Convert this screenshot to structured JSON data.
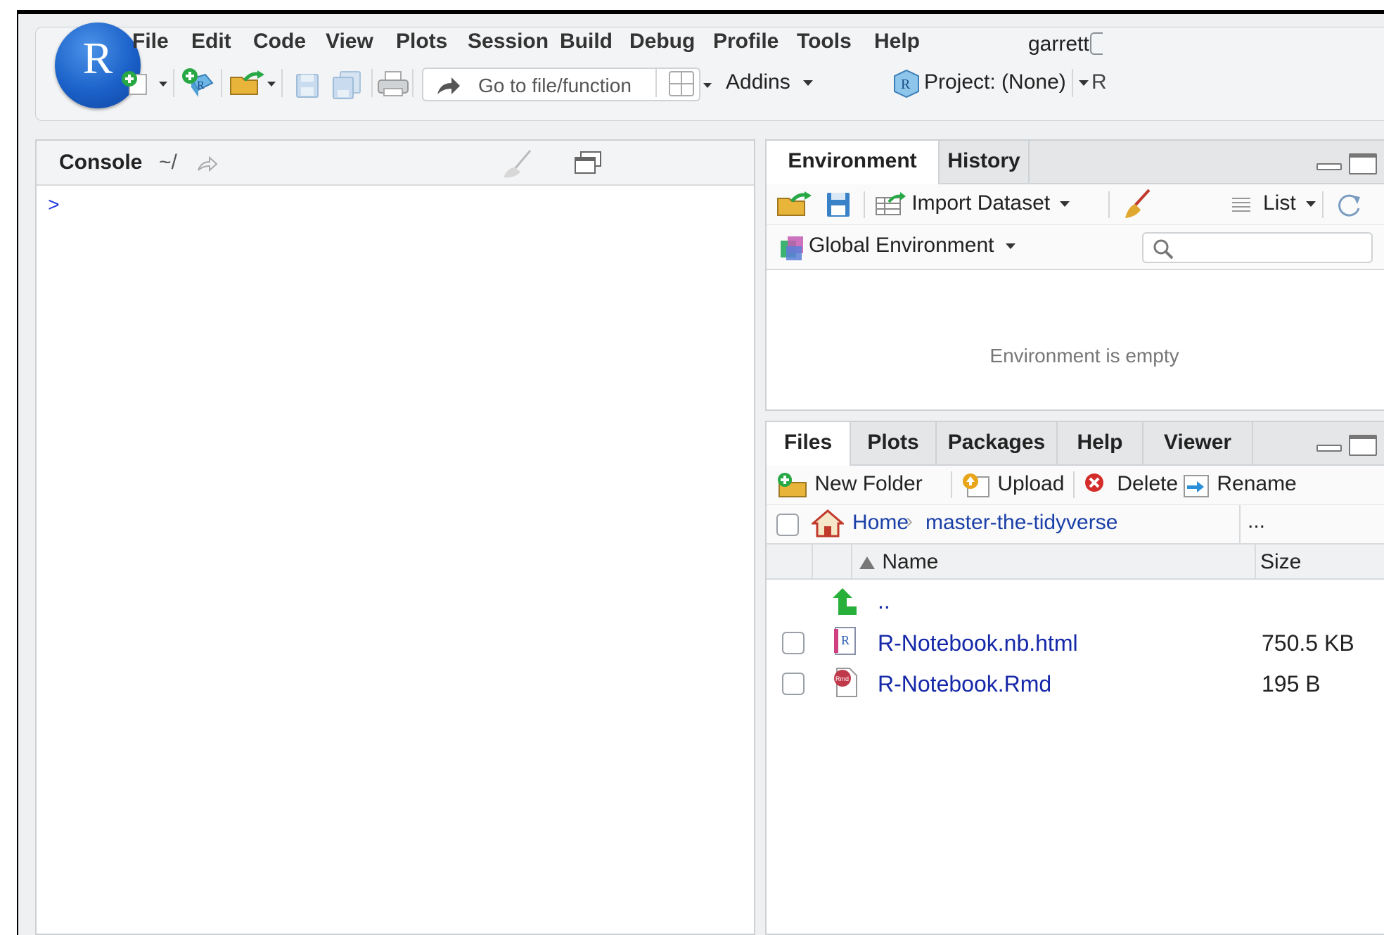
{
  "menu": [
    "File",
    "Edit",
    "Code",
    "View",
    "Plots",
    "Session",
    "Build",
    "Debug",
    "Profile",
    "Tools",
    "Help"
  ],
  "user": "garrett",
  "logo_letter": "R",
  "toolbar": {
    "goto_placeholder": "Go to file/function",
    "addins_label": "Addins",
    "project_label": "Project: (None)",
    "r_version_partial": "R"
  },
  "console": {
    "title": "Console",
    "path": "~/",
    "prompt": ">"
  },
  "environment": {
    "tabs": [
      "Environment",
      "History"
    ],
    "import_label": "Import Dataset",
    "list_label": "List",
    "scope_label": "Global Environment",
    "empty_message": "Environment is empty"
  },
  "files": {
    "tabs": [
      "Files",
      "Plots",
      "Packages",
      "Help",
      "Viewer"
    ],
    "new_folder_label": "New Folder",
    "upload_label": "Upload",
    "delete_label": "Delete",
    "rename_label": "Rename",
    "breadcrumb": [
      "Home",
      "master-the-tidyverse"
    ],
    "more_label": "...",
    "col_name": "Name",
    "col_size": "Size",
    "parent_label": "..",
    "rows": [
      {
        "name": "R-Notebook.nb.html",
        "size": "750.5 KB",
        "icon": "r-notebook-icon"
      },
      {
        "name": "R-Notebook.Rmd",
        "size": "195 B",
        "icon": "rmd-file-icon"
      }
    ]
  },
  "colors": {
    "accent": "#1b61c9",
    "link": "#1528a8",
    "prompt": "#1b34e0"
  }
}
